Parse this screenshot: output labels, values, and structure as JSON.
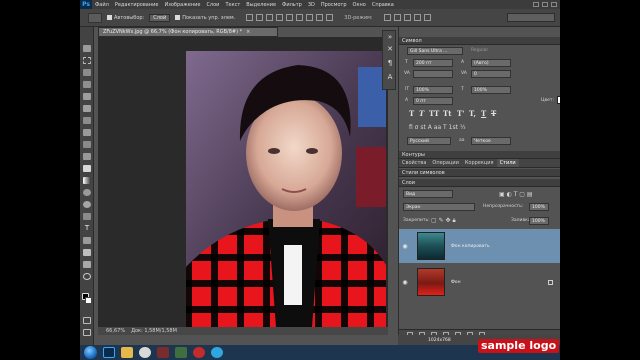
{
  "app": {
    "logo": "Ps",
    "menu": [
      "Файл",
      "Редактирование",
      "Изображение",
      "Слои",
      "Текст",
      "Выделение",
      "Фильтр",
      "3D",
      "Просмотр",
      "Окно",
      "Справка"
    ]
  },
  "options_bar": {
    "autoselect_label": "Автовыбор:",
    "autoselect_value": "Слой",
    "show_controls_label": "Показать упр. элем.",
    "mode_3d_label": "3D-режим:"
  },
  "document": {
    "tab_title": "ZFuZVNkWs.jpg @ 66,7% (Фон копировать, RGB/8#) *",
    "close_glyph": "×",
    "zoom": "66,67%",
    "doc_size": "Док: 1,58M/1,58M"
  },
  "character_panel": {
    "tab": "Символ",
    "font_family": "Gill Sans Ultra ...",
    "font_style": "Regular",
    "font_size": "200 пт",
    "leading": "(Авто)",
    "kerning": "",
    "tracking": "0",
    "vertical_scale": "100%",
    "horizontal_scale": "100%",
    "baseline_shift": "0 пт",
    "color_label": "Цвет:",
    "language": "Русский",
    "antialias": "Четкое"
  },
  "secondary_tabs": {
    "paths": "Контуры",
    "row": [
      "Свойства",
      "Операции",
      "Коррекция",
      "Стили"
    ],
    "active": "Стили",
    "styles_panel": "Стили символов"
  },
  "layers_panel": {
    "tab": "Слои",
    "kind_filter": "Вид",
    "blend_mode": "Экран",
    "opacity_label": "Непрозрачность:",
    "opacity": "100%",
    "lock_label": "Закрепить:",
    "fill_label": "Заливка:",
    "fill": "100%",
    "layers": [
      {
        "name": "Фон копировать",
        "selected": true
      },
      {
        "name": "Фон",
        "selected": false
      }
    ]
  },
  "status": {
    "dimensions": "1024x768",
    "watermark": "sample logo"
  },
  "colors": {
    "app_bg": "#535353",
    "selection": "#6d8fb0",
    "watermark_bg": "#c8121a",
    "photoshop_blue": "#39a7f2"
  }
}
